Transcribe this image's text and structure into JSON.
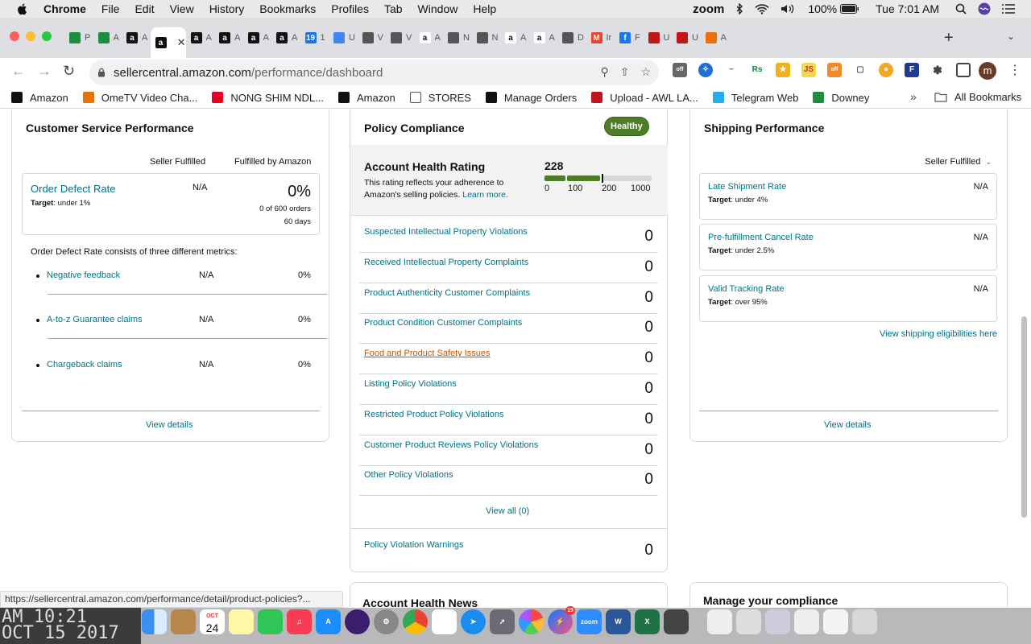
{
  "menubar": {
    "app": "Chrome",
    "items": [
      "File",
      "Edit",
      "View",
      "History",
      "Bookmarks",
      "Profiles",
      "Tab",
      "Window",
      "Help"
    ],
    "zoom": "zoom",
    "battery": "100%",
    "clock": "Tue 7:01 AM"
  },
  "tabs": [
    {
      "icon": "sheets-icon",
      "color": "#1e8e3e",
      "glyph": "",
      "label": "P"
    },
    {
      "icon": "sheets-icon",
      "color": "#1e8e3e",
      "glyph": "",
      "label": "A"
    },
    {
      "icon": "amazon-icon",
      "color": "#111111",
      "glyph": "a",
      "label": "A"
    },
    {
      "icon": "amazon-icon",
      "color": "#111111",
      "glyph": "a",
      "label": "",
      "active": true
    },
    {
      "icon": "amazon-icon",
      "color": "#111111",
      "glyph": "a",
      "label": "A"
    },
    {
      "icon": "amazon-icon",
      "color": "#111111",
      "glyph": "a",
      "label": "A"
    },
    {
      "icon": "amazon-icon",
      "color": "#111111",
      "glyph": "a",
      "label": "A"
    },
    {
      "icon": "amazon-icon",
      "color": "#111111",
      "glyph": "a",
      "label": "A"
    },
    {
      "icon": "calendar-icon",
      "color": "#1a73e8",
      "glyph": "19",
      "label": "1"
    },
    {
      "icon": "docs-icon",
      "color": "#4285f4",
      "glyph": "",
      "label": "U"
    },
    {
      "icon": "box-icon",
      "color": "#555555",
      "glyph": "",
      "label": "V"
    },
    {
      "icon": "box-icon",
      "color": "#555555",
      "glyph": "",
      "label": "V"
    },
    {
      "icon": "amazon-icon",
      "color": "#ffffff",
      "glyph": "a",
      "label": "A"
    },
    {
      "icon": "box-icon",
      "color": "#555555",
      "glyph": "",
      "label": "N"
    },
    {
      "icon": "box-icon",
      "color": "#555555",
      "glyph": "",
      "label": "N"
    },
    {
      "icon": "amazon-icon",
      "color": "#ffffff",
      "glyph": "a",
      "label": "A"
    },
    {
      "icon": "amazon-icon",
      "color": "#ffffff",
      "glyph": "a",
      "label": "A"
    },
    {
      "icon": "box-icon",
      "color": "#555555",
      "glyph": "",
      "label": "D"
    },
    {
      "icon": "gmail-icon",
      "color": "#ea4335",
      "glyph": "M",
      "label": "Ir"
    },
    {
      "icon": "facebook-icon",
      "color": "#1877f2",
      "glyph": "f",
      "label": "F"
    },
    {
      "icon": "flag-icon",
      "color": "#c0161b",
      "glyph": "",
      "label": "U"
    },
    {
      "icon": "flag-icon",
      "color": "#c0161b",
      "glyph": "",
      "label": "U"
    },
    {
      "icon": "pencil-icon",
      "color": "#e8710a",
      "glyph": "",
      "label": "A"
    }
  ],
  "address": {
    "host": "sellercentral.amazon.com",
    "path": "/performance/dashboard"
  },
  "bookmarks": [
    {
      "label": "Amazon",
      "icon": "amazon-icon",
      "color": "#111111"
    },
    {
      "label": "OmeTV Video Cha...",
      "icon": "ometv-icon",
      "color": "#e8710a"
    },
    {
      "label": "NONG SHIM NDL...",
      "icon": "pinterest-icon",
      "color": "#e60023"
    },
    {
      "label": "Amazon",
      "icon": "amazon-icon",
      "color": "#111111"
    },
    {
      "label": "STORES",
      "icon": "folder-icon",
      "color": "#ffffff"
    },
    {
      "label": "Manage Orders",
      "icon": "amazon-icon",
      "color": "#111111"
    },
    {
      "label": "Upload - AWL LA...",
      "icon": "flag-icon",
      "color": "#c0161b"
    },
    {
      "label": "Telegram Web",
      "icon": "telegram-icon",
      "color": "#2aabee"
    },
    {
      "label": "Downey",
      "icon": "sheets-icon",
      "color": "#1e8e3e"
    }
  ],
  "bookmarks_all": "All Bookmarks",
  "customer_service": {
    "title": "Customer Service Performance",
    "col_seller": "Seller Fulfilled",
    "col_fba": "Fulfilled by Amazon",
    "odr_label": "Order Defect Rate",
    "odr_target_label": "Target",
    "odr_target": ": under 1%",
    "odr_seller": "N/A",
    "odr_fba": "0%",
    "odr_orders": "0 of 600 orders",
    "odr_days": "60 days",
    "consists": "Order Defect Rate consists of three different metrics:",
    "metrics": [
      {
        "label": "Negative feedback",
        "seller": "N/A",
        "fba": "0%"
      },
      {
        "label": "A-to-z Guarantee claims",
        "seller": "N/A",
        "fba": "0%"
      },
      {
        "label": "Chargeback claims",
        "seller": "N/A",
        "fba": "0%"
      }
    ],
    "view_details": "View details"
  },
  "policy": {
    "title": "Policy Compliance",
    "badge": "Healthy",
    "ahr_title": "Account Health Rating",
    "ahr_desc": "This rating reflects your adherence to Amazon's selling policies.",
    "learn_more": "Learn more.",
    "ahr_score": "228",
    "ahr_scale": [
      "0",
      "100",
      "200",
      "1000"
    ],
    "rows": [
      {
        "label": "Suspected Intellectual Property Violations",
        "value": "0"
      },
      {
        "label": "Received Intellectual Property Complaints",
        "value": "0"
      },
      {
        "label": "Product Authenticity Customer Complaints",
        "value": "0"
      },
      {
        "label": "Product Condition Customer Complaints",
        "value": "0"
      },
      {
        "label": "Food and Product Safety Issues",
        "value": "0",
        "hover": true
      },
      {
        "label": "Listing Policy Violations",
        "value": "0"
      },
      {
        "label": "Restricted Product Policy Violations",
        "value": "0"
      },
      {
        "label": "Customer Product Reviews Policy Violations",
        "value": "0"
      },
      {
        "label": "Other Policy Violations",
        "value": "0"
      }
    ],
    "view_all": "View all (0)",
    "warnings_label": "Policy Violation Warnings",
    "warnings_value": "0"
  },
  "shipping": {
    "title": "Shipping Performance",
    "dropdown": "Seller Fulfilled",
    "boxes": [
      {
        "label": "Late Shipment Rate",
        "target_label": "Target",
        "target": ": under 4%",
        "value": "N/A"
      },
      {
        "label": "Pre-fulfillment Cancel Rate",
        "target_label": "Target",
        "target": ": under 2.5%",
        "value": "N/A"
      },
      {
        "label": "Valid Tracking Rate",
        "target_label": "Target",
        "target": ": over 95%",
        "value": "N/A"
      }
    ],
    "eligibility_link": "View shipping eligibilities here",
    "view_details": "View details"
  },
  "account_news": "Account Health News",
  "manage_compliance": "Manage your compliance",
  "status_url": "https://sellercentral.amazon.com/performance/detail/product-policies?...",
  "dock": {
    "clock_line1": "AM 10:21",
    "clock_line2": "OCT 15 2017",
    "calendar_day": "24",
    "calendar_month": "OCT",
    "messenger_badge": "15"
  }
}
